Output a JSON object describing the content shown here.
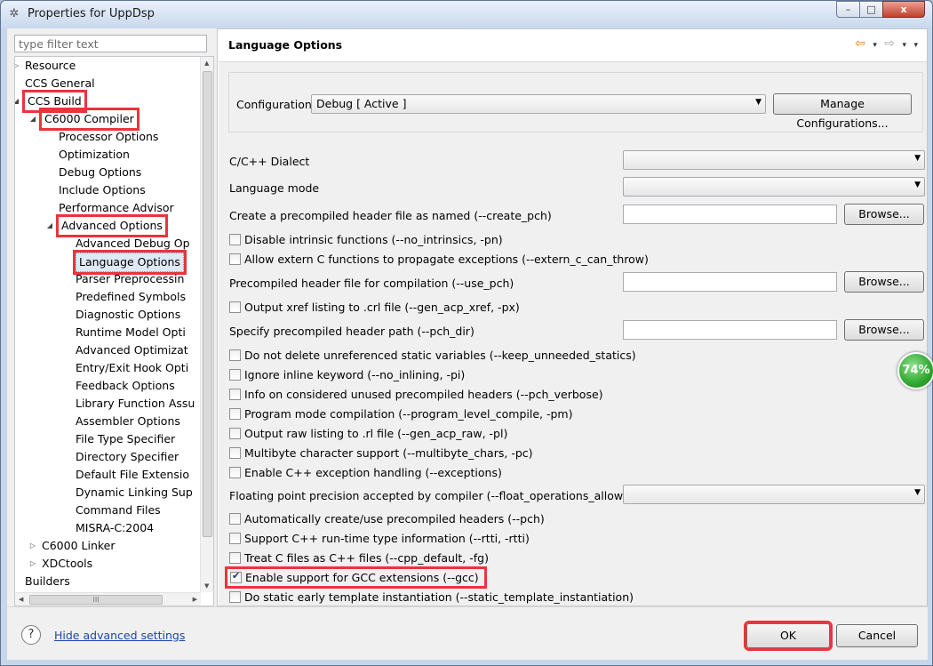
{
  "window": {
    "title": "Properties for UppDsp",
    "controls": {
      "minimize": "–",
      "maximize": "□",
      "close": "x"
    }
  },
  "filter": {
    "placeholder": "type filter text"
  },
  "tree": {
    "items": [
      {
        "label": "Resource",
        "arrow": "▷"
      },
      {
        "label": "CCS General",
        "arrow": ""
      },
      {
        "label": "CCS Build",
        "arrow": "◢"
      },
      {
        "label": "C6000 Compiler",
        "arrow": "◢"
      },
      {
        "label": "Processor Options",
        "arrow": ""
      },
      {
        "label": "Optimization",
        "arrow": ""
      },
      {
        "label": "Debug Options",
        "arrow": ""
      },
      {
        "label": "Include Options",
        "arrow": ""
      },
      {
        "label": "Performance Advisor",
        "arrow": ""
      },
      {
        "label": "Advanced Options",
        "arrow": "◢"
      },
      {
        "label": "Advanced Debug Op",
        "arrow": ""
      },
      {
        "label": "Language Options",
        "arrow": ""
      },
      {
        "label": "Parser Preprocessin",
        "arrow": ""
      },
      {
        "label": "Predefined Symbols",
        "arrow": ""
      },
      {
        "label": "Diagnostic Options",
        "arrow": ""
      },
      {
        "label": "Runtime Model Opti",
        "arrow": ""
      },
      {
        "label": "Advanced Optimizat",
        "arrow": ""
      },
      {
        "label": "Entry/Exit Hook Opti",
        "arrow": ""
      },
      {
        "label": "Feedback Options",
        "arrow": ""
      },
      {
        "label": "Library Function Assu",
        "arrow": ""
      },
      {
        "label": "Assembler Options",
        "arrow": ""
      },
      {
        "label": "File Type Specifier",
        "arrow": ""
      },
      {
        "label": "Directory Specifier",
        "arrow": ""
      },
      {
        "label": "Default File Extensio",
        "arrow": ""
      },
      {
        "label": "Dynamic Linking Sup",
        "arrow": ""
      },
      {
        "label": "Command Files",
        "arrow": ""
      },
      {
        "label": "MISRA-C:2004",
        "arrow": ""
      },
      {
        "label": "C6000 Linker",
        "arrow": "▷"
      },
      {
        "label": "XDCtools",
        "arrow": "▷"
      },
      {
        "label": "Builders",
        "arrow": ""
      }
    ],
    "hscroll_grip": "III"
  },
  "page": {
    "title": "Language Options",
    "nav": {
      "back": "⇦",
      "forward": "⇨",
      "menu": "▾"
    }
  },
  "config": {
    "label": "Configuration:",
    "value": "Debug  [ Active ]",
    "manage_label": "Manage Configurations..."
  },
  "options": {
    "dialect_label": "C/C++ Dialect",
    "dialect_value": "",
    "mode_label": "Language mode",
    "mode_value": "",
    "create_pch_label": "Create a precompiled header file as named (--create_pch)",
    "create_pch_value": "",
    "browse_label": "Browse...",
    "no_intrinsics": {
      "label": "Disable intrinsic functions (--no_intrinsics, -pn)",
      "checked": false
    },
    "extern_c": {
      "label": "Allow extern C functions to propagate exceptions (--extern_c_can_throw)",
      "checked": false
    },
    "use_pch_label": "Precompiled header file for compilation (--use_pch)",
    "use_pch_value": "",
    "gen_acp_xref": {
      "label": "Output xref listing to .crl file (--gen_acp_xref, -px)",
      "checked": false
    },
    "pch_dir_label": "Specify precompiled header path (--pch_dir)",
    "pch_dir_value": "",
    "keep_unneeded": {
      "label": "Do not delete unreferenced static variables (--keep_unneeded_statics)",
      "checked": false
    },
    "no_inlining": {
      "label": "Ignore inline keyword (--no_inlining, -pi)",
      "checked": false
    },
    "pch_verbose": {
      "label": "Info on considered  unused precompiled headers (--pch_verbose)",
      "checked": false
    },
    "program_level": {
      "label": "Program mode compilation (--program_level_compile, -pm)",
      "checked": false
    },
    "gen_acp_raw": {
      "label": "Output raw listing to .rl file (--gen_acp_raw, -pl)",
      "checked": false
    },
    "multibyte": {
      "label": "Multibyte character support (--multibyte_chars, -pc)",
      "checked": false
    },
    "exceptions": {
      "label": "Enable C++ exception handling (--exceptions)",
      "checked": false
    },
    "float_ops_label": "Floating point precision accepted by compiler (--float_operations_allowed)",
    "float_ops_value": "",
    "auto_pch": {
      "label": "Automatically create/use precompiled headers (--pch)",
      "checked": false
    },
    "rtti": {
      "label": "Support C++ run-time type information (--rtti, -rtti)",
      "checked": false
    },
    "cpp_default": {
      "label": "Treat C files as C++ files (--cpp_default, -fg)",
      "checked": false
    },
    "gcc": {
      "label": "Enable support for GCC extensions (--gcc)",
      "checked": true
    },
    "static_template": {
      "label": "Do static early template instantiation (--static_template_instantiation)",
      "checked": false
    }
  },
  "badge": {
    "percent": "74%"
  },
  "footer": {
    "help": "?",
    "hide_advanced": "Hide advanced settings",
    "ok_label": "OK",
    "cancel_label": "Cancel"
  },
  "colors": {
    "highlight": "#e8353b",
    "link": "#1c47a8",
    "badge": "#2fa82f"
  }
}
